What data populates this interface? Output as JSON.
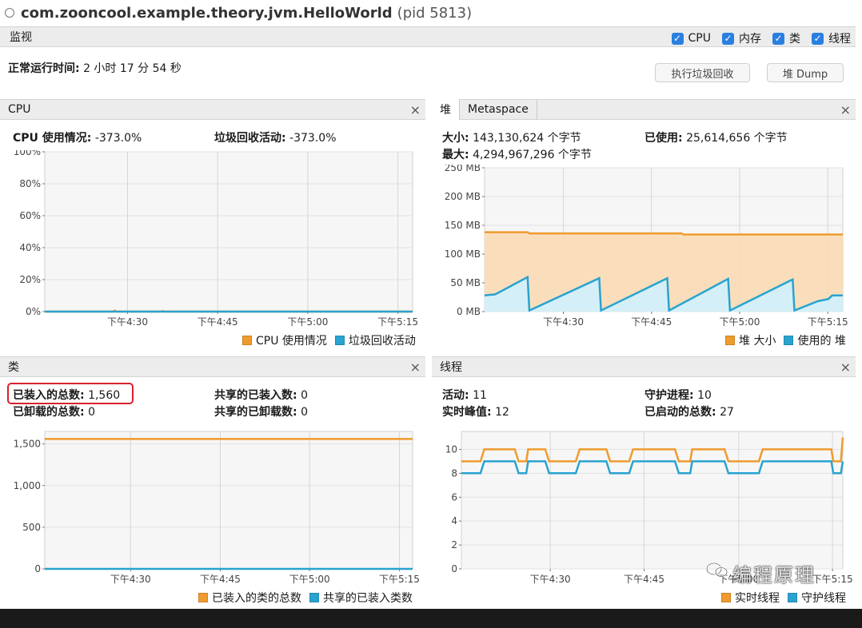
{
  "window": {
    "title": "com.zooncool.example.theory.jvm.HelloWorld",
    "pid": "(pid 5813)"
  },
  "monitor": {
    "label": "监视",
    "checkboxes": [
      {
        "label": "CPU",
        "checked": true
      },
      {
        "label": "内存",
        "checked": true
      },
      {
        "label": "类",
        "checked": true
      },
      {
        "label": "线程",
        "checked": true
      }
    ]
  },
  "uptime": {
    "label": "正常运行时间:",
    "value": "2 小时 17 分 54 秒"
  },
  "buttons": {
    "gc": "执行垃圾回收",
    "heap_dump": "堆 Dump"
  },
  "colors": {
    "orange": "#ef9b2d",
    "blue": "#29a3cf",
    "orange_fill": "#f9d8b0",
    "blue_fill": "#d6f0f8",
    "highlight": "#d8222a"
  },
  "icons": {
    "close": "close-icon",
    "checkbox": "checkmark-icon",
    "title": "circle-icon"
  },
  "cpu_panel": {
    "title": "CPU",
    "close": "×",
    "usage_label": "CPU 使用情况:",
    "usage_value": "-373.0%",
    "gc_label": "垃圾回收活动:",
    "gc_value": "-373.0%",
    "legend": [
      "CPU 使用情况",
      "垃圾回收活动"
    ]
  },
  "memory_panel": {
    "tabs": [
      "堆",
      "Metaspace"
    ],
    "close": "×",
    "size_label": "大小:",
    "size_value": "143,130,624 个字节",
    "used_label": "已使用:",
    "used_value": "25,614,656 个字节",
    "max_label": "最大:",
    "max_value": "4,294,967,296 个字节",
    "legend": [
      "堆 大小",
      "使用的 堆"
    ]
  },
  "classes_panel": {
    "title": "类",
    "close": "×",
    "loaded_label": "已装入的总数:",
    "loaded_value": "1,560",
    "shared_loaded_label": "共享的已装入数:",
    "shared_loaded_value": "0",
    "unloaded_label": "已卸载的总数:",
    "unloaded_value": "0",
    "shared_unloaded_label": "共享的已卸载数:",
    "shared_unloaded_value": "0",
    "legend": [
      "已装入的类的总数",
      "共享的已装入类数"
    ]
  },
  "threads_panel": {
    "title": "线程",
    "close": "×",
    "live_label": "活动:",
    "live_value": "11",
    "daemon_label": "守护进程:",
    "daemon_value": "10",
    "peak_label": "实时峰值:",
    "peak_value": "12",
    "started_label": "已启动的总数:",
    "started_value": "27",
    "legend": [
      "实时线程",
      "守护线程"
    ]
  },
  "watermark": "编程原理",
  "chart_data": [
    {
      "id": "cpu",
      "type": "line",
      "x_ticks": [
        "下午4:30",
        "下午4:45",
        "下午5:00",
        "下午5:15"
      ],
      "y_ticks": [
        "0%",
        "20%",
        "40%",
        "60%",
        "80%",
        "100%"
      ],
      "ylim": [
        0,
        100
      ],
      "xlim": [
        0,
        1
      ],
      "series": [
        {
          "name": "CPU 使用情况",
          "color": "#ef9b2d",
          "x": [
            0,
            0.185,
            0.19,
            0.195,
            0.315,
            0.32,
            0.325,
            1
          ],
          "values": [
            0,
            0,
            0.6,
            0,
            0,
            0.4,
            0,
            0
          ]
        },
        {
          "name": "垃圾回收活动",
          "color": "#29a3cf",
          "x": [
            0,
            1
          ],
          "values": [
            0,
            0
          ]
        }
      ],
      "grid": true
    },
    {
      "id": "heap",
      "type": "area",
      "x_ticks": [
        "下午4:30",
        "下午4:45",
        "下午5:00",
        "下午5:15"
      ],
      "y_ticks": [
        "0 MB",
        "50 MB",
        "100 MB",
        "150 MB",
        "200 MB",
        "250 MB"
      ],
      "ylim": [
        0,
        250
      ],
      "xlim": [
        0,
        1
      ],
      "series": [
        {
          "name": "堆 大小",
          "color": "#ef9b2d",
          "x": [
            0,
            0.12,
            0.125,
            0.55,
            0.555,
            1
          ],
          "values": [
            138,
            138,
            136,
            136,
            134,
            134
          ]
        },
        {
          "name": "使用的 堆",
          "color": "#29a3cf",
          "x": [
            0,
            0.03,
            0.12,
            0.125,
            0.32,
            0.325,
            0.51,
            0.515,
            0.68,
            0.685,
            0.86,
            0.865,
            0.93,
            0.945,
            0.96,
            0.97,
            1
          ],
          "values": [
            28,
            30,
            60,
            2,
            58,
            2,
            58,
            2,
            57,
            2,
            56,
            2,
            18,
            20,
            22,
            28,
            28
          ]
        }
      ],
      "grid": true
    },
    {
      "id": "classes",
      "type": "line",
      "x_ticks": [
        "下午4:30",
        "下午4:45",
        "下午5:00",
        "下午5:15"
      ],
      "y_ticks": [
        "0",
        "500",
        "1,000",
        "1,500"
      ],
      "ylim": [
        0,
        1650
      ],
      "xlim": [
        0,
        1
      ],
      "series": [
        {
          "name": "已装入的类的总数",
          "color": "#ef9b2d",
          "x": [
            0,
            1
          ],
          "values": [
            1560,
            1560
          ]
        },
        {
          "name": "共享的已装入类数",
          "color": "#29a3cf",
          "x": [
            0,
            1
          ],
          "values": [
            0,
            0
          ]
        }
      ],
      "grid": true
    },
    {
      "id": "threads",
      "type": "line",
      "x_ticks": [
        "下午4:30",
        "下午4:45",
        "下午5:00",
        "下午5:15"
      ],
      "y_ticks": [
        "0",
        "2",
        "4",
        "6",
        "8",
        "10"
      ],
      "ylim": [
        0,
        11.5
      ],
      "xlim": [
        0,
        1
      ],
      "series": [
        {
          "name": "实时线程",
          "color": "#ef9b2d",
          "x": [
            0,
            0.05,
            0.06,
            0.14,
            0.15,
            0.17,
            0.175,
            0.22,
            0.23,
            0.3,
            0.31,
            0.38,
            0.39,
            0.44,
            0.45,
            0.56,
            0.57,
            0.6,
            0.605,
            0.69,
            0.7,
            0.78,
            0.79,
            0.97,
            0.975,
            0.995,
            1
          ],
          "values": [
            9,
            9,
            10,
            10,
            9,
            9,
            10,
            10,
            9,
            9,
            10,
            10,
            9,
            9,
            10,
            10,
            9,
            9,
            10,
            10,
            9,
            9,
            10,
            10,
            9,
            9,
            11
          ]
        },
        {
          "name": "守护线程",
          "color": "#29a3cf",
          "x": [
            0,
            0.05,
            0.06,
            0.14,
            0.15,
            0.17,
            0.175,
            0.22,
            0.23,
            0.3,
            0.31,
            0.38,
            0.39,
            0.44,
            0.45,
            0.56,
            0.57,
            0.6,
            0.605,
            0.69,
            0.7,
            0.78,
            0.79,
            0.97,
            0.975,
            0.995,
            1
          ],
          "values": [
            8,
            8,
            9,
            9,
            8,
            8,
            9,
            9,
            8,
            8,
            9,
            9,
            8,
            8,
            9,
            9,
            8,
            8,
            9,
            9,
            8,
            8,
            9,
            9,
            8,
            8,
            9
          ]
        }
      ],
      "grid": true
    }
  ]
}
